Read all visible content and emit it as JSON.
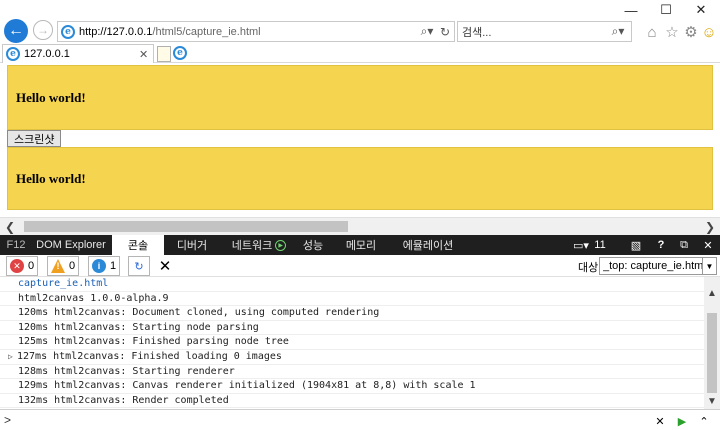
{
  "window": {
    "minimize_icon": "minimize-icon",
    "maximize_icon": "maximize-icon",
    "close_icon": "close-icon"
  },
  "address": {
    "url_host": "http://127.0.0.1",
    "url_path": "/html5/capture_ie.html"
  },
  "search": {
    "placeholder": "검색..."
  },
  "tab": {
    "label": "127.0.0.1"
  },
  "page": {
    "hello_1": "Hello world!",
    "button_label": "스크린샷",
    "hello_2": "Hello world!",
    "accent_color": "#f5d44f"
  },
  "devtools": {
    "tabs": [
      {
        "label": "F12"
      },
      {
        "label": "DOM Explorer"
      },
      {
        "label": "콘솔"
      },
      {
        "label": "디버거"
      },
      {
        "label": "네트워크"
      },
      {
        "label": "성능"
      },
      {
        "label": "메모리"
      },
      {
        "label": "에뮬레이션"
      }
    ],
    "active_tab": "콘솔",
    "emulation_count": "11",
    "help_label": "?"
  },
  "console": {
    "error_count": "0",
    "warning_count": "0",
    "info_count": "1",
    "target_label": "대상",
    "target_value": "_top: capture_ie.html",
    "lines": [
      "capture_ie.html",
      "html2canvas 1.0.0-alpha.9",
      "120ms html2canvas: Document cloned, using computed rendering",
      "120ms html2canvas: Starting node parsing",
      "125ms html2canvas: Finished parsing node tree",
      "127ms html2canvas: Finished loading 0 images",
      "128ms html2canvas: Starting renderer",
      "129ms html2canvas: Canvas renderer initialized (1904x81 at 8,8) with scale 1",
      "132ms html2canvas: Render completed"
    ],
    "prompt": ">"
  }
}
